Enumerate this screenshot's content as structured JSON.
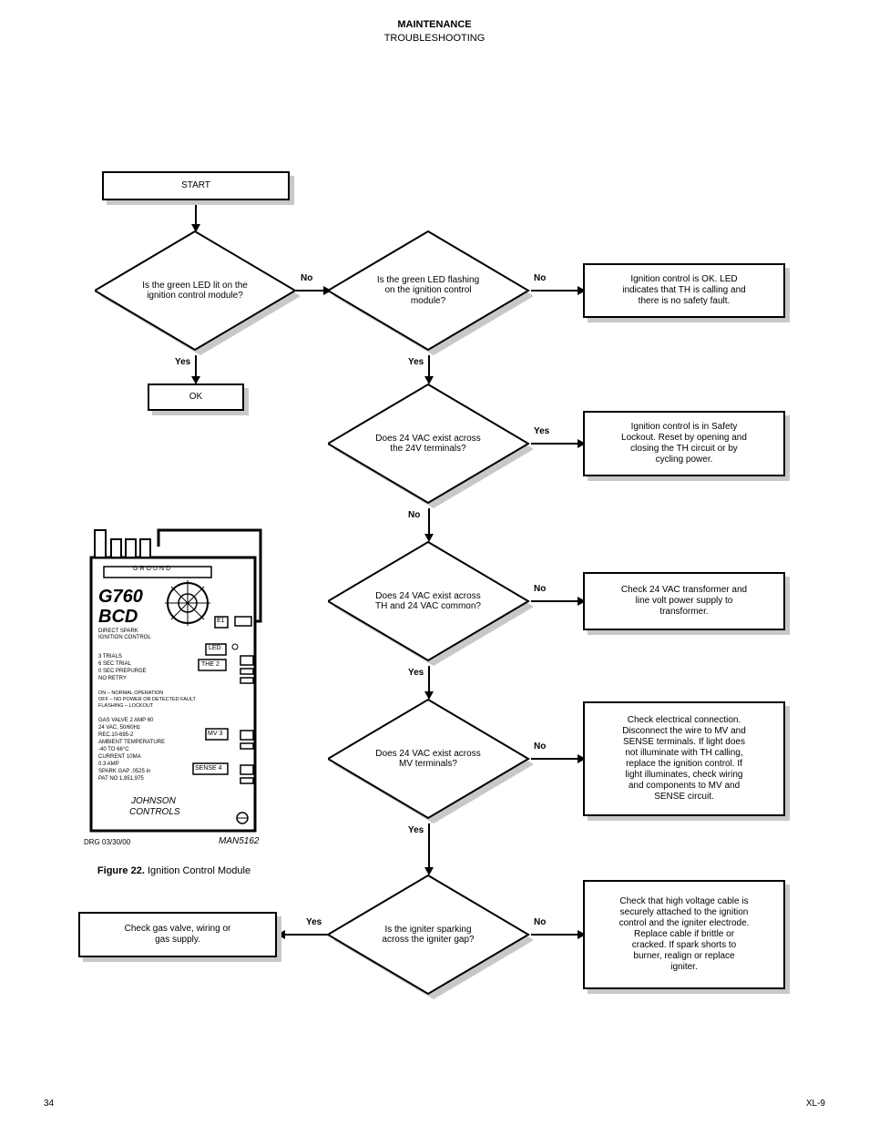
{
  "header": {
    "title_line1": "MAINTENANCE",
    "title_line2": "TROUBLESHOOTING"
  },
  "nodes": {
    "start": {
      "label": "START"
    },
    "ok": {
      "label": "OK"
    },
    "d1": {
      "text": "Is the green LED lit on the\nignition control module?"
    },
    "d2": {
      "text": "Is the green LED flashing\non the ignition control\nmodule?"
    },
    "d3": {
      "text": "Does 24 VAC exist across\nthe 24V terminals?"
    },
    "d4": {
      "text": "Does 24 VAC exist across\nTH and 24 VAC common?"
    },
    "d5": {
      "text": "Does 24 VAC exist across\nMV terminals?"
    },
    "d6": {
      "text": "Is the igniter sparking\nacross the igniter gap?"
    },
    "a1": {
      "text": "Ignition control is OK. LED\nindicates that TH is calling and\nthere is no safety fault."
    },
    "a2": {
      "text": "Ignition control is in Safety\nLockout. Reset by opening and\nclosing the TH circuit or by\ncycling power."
    },
    "a3": {
      "text": "Check 24 VAC transformer and\nline volt power supply to\ntransformer."
    },
    "a4": {
      "text": "Check electrical connection.\nDisconnect the wire to MV and\nSENSE terminals. If light does\nnot illuminate with TH calling,\nreplace the ignition control. If\nlight illuminates, check wiring\nand components to MV and\nSENSE circuit."
    },
    "a5": {
      "text": "Check that high voltage cable is\nsecurely attached to the ignition\ncontrol and the igniter electrode.\nReplace cable if brittle or\ncracked. If spark shorts to\nburner, realign or replace\nigniter."
    },
    "r6_yes": {
      "text": "Check gas valve, wiring or\ngas supply."
    }
  },
  "labels": {
    "yes": "Yes",
    "no": "No"
  },
  "device": {
    "model": "G760",
    "series": "BCD",
    "subtitle1": "DIRECT SPARK",
    "subtitle2": "IGNITION CONTROL",
    "spec1": "3 TRIALS",
    "spec2": "6 SEC TRIAL",
    "spec3": "0 SEC PREPURGE",
    "spec4": "NO RETRY",
    "led_on": "ON – NORMAL OPERATION",
    "led_off": "OFF – NO POWER OR DETECTED FAULT",
    "led_flash": "FLASHING – LOCKOUT",
    "rating1": "GAS VALVE 2 AMP 60",
    "rating2": "24 VAC, 50/60Hz",
    "rating3": "REC.10-695-2",
    "rating4": "AMBIENT TEMPERATURE",
    "rating5": "-40 TO 66°C",
    "rating6": "CURRENT 10MA",
    "rating7": "0.3 AMP",
    "rating8": "SPARK GAP .0525 in",
    "rating9": "PAT NO 1,951,975",
    "brand1": "JOHNSON",
    "brand2": "CONTROLS",
    "term_ground": "GROUND",
    "term_e1": "E1",
    "term_led": "LED",
    "term_the2": "THE 2",
    "term_mv3": "MV 3",
    "term_sense4": "SENSE 4",
    "pcb_date": "DRG 03/30/00",
    "pcb_code": "MAN5162",
    "figure_title": "Figure 22.",
    "figure_desc": "Ignition Control Module"
  },
  "footer": {
    "page": "34",
    "model": "XL-9"
  }
}
